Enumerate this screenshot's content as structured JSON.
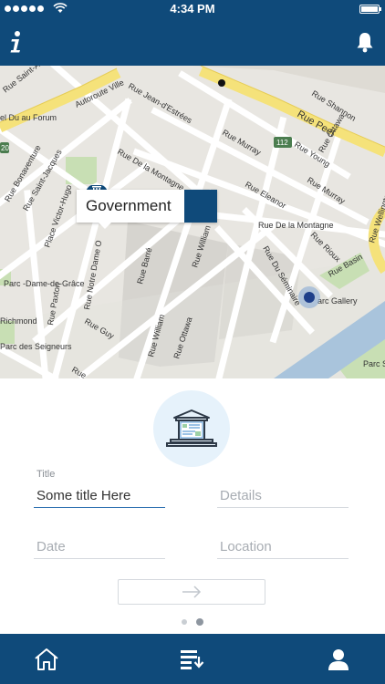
{
  "status_bar": {
    "time": "4:34 PM",
    "icons": [
      "signal-dots-icon",
      "wifi-icon",
      "battery-icon"
    ]
  },
  "nav": {
    "left_icon": "info-icon",
    "right_icon": "bell-icon"
  },
  "map": {
    "street_labels": [
      "Rue Saint-A",
      "Autoroute Ville",
      "Rue Jean-d'Estrées",
      "Rue Shannon",
      "Rue Peel",
      "Rue Young",
      "Rue Ottawa",
      "112",
      "Rue Murray",
      "Rue Eleanor",
      "Rue Murray",
      "Rue De la Montagne",
      "Rue De la Montagne",
      "Rue Wellingto",
      "Rue Saint-Jacques",
      "Rue Bonaventure",
      "Place Victor-Hugo",
      "Rue Barré",
      "Rue William",
      "Rue Du Séminaire",
      "Rue Rioux",
      "Rue Basin",
      "arc Gallery",
      "Rue Notre Dame O",
      "Rue Paxton",
      "Rue Guy",
      "Rue William",
      "Rue Ottawa",
      "Parc -Dame-de-Grâce",
      "Richmond",
      "Parc des Seigneurs",
      "Parc St-Pa",
      "Rue",
      "el Du au Forum",
      "20"
    ],
    "callout_label": "Government",
    "callout_icon": "arrow-right-icon",
    "marker_icon": "government-building-icon",
    "location_icon": "current-location-icon"
  },
  "form": {
    "category_icon": "government-building-icon",
    "title_label": "Title",
    "title_value": "Some title Here",
    "details_placeholder": "Details",
    "date_placeholder": "Date",
    "location_placeholder": "Location",
    "submit_icon": "arrow-right-icon"
  },
  "pager": {
    "pages": 2,
    "active": 2
  },
  "tabbar": {
    "icons": [
      "home-icon",
      "list-download-icon",
      "user-icon"
    ]
  },
  "colors": {
    "primary": "#0f4a7a",
    "accent_blue": "#2a6fb0",
    "map_bg": "#e8e6e1",
    "highway": "#f5e27a"
  }
}
